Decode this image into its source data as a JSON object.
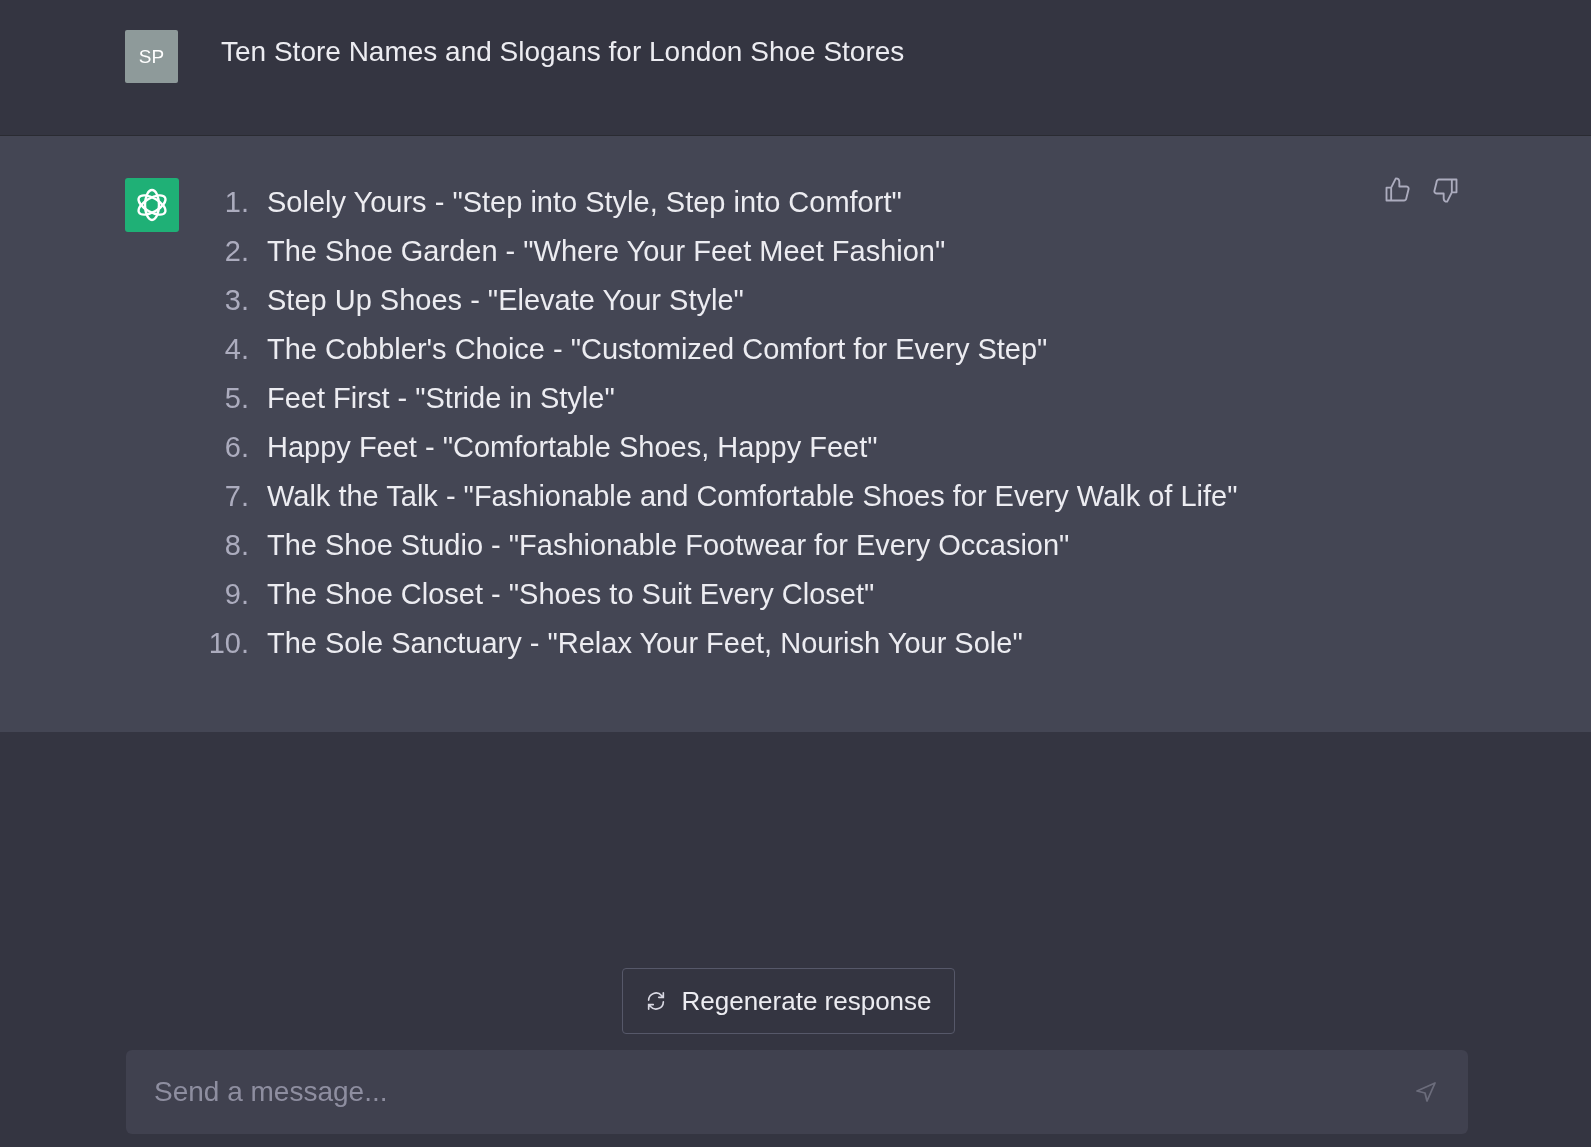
{
  "user_message": {
    "avatar": "SP",
    "text": "Ten Store Names and Slogans for London Shoe Stores"
  },
  "assistant_message": {
    "items": [
      {
        "number": "1.",
        "text": "Solely Yours - \"Step into Style, Step into Comfort\""
      },
      {
        "number": "2.",
        "text": "The Shoe Garden - \"Where Your Feet Meet Fashion\""
      },
      {
        "number": "3.",
        "text": "Step Up Shoes - \"Elevate Your Style\""
      },
      {
        "number": "4.",
        "text": "The Cobbler's Choice - \"Customized Comfort for Every Step\""
      },
      {
        "number": "5.",
        "text": "Feet First - \"Stride in Style\""
      },
      {
        "number": "6.",
        "text": "Happy Feet - \"Comfortable Shoes, Happy Feet\""
      },
      {
        "number": "7.",
        "text": "Walk the Talk - \"Fashionable and Comfortable Shoes for Every Walk of Life\""
      },
      {
        "number": "8.",
        "text": "The Shoe Studio - \"Fashionable Footwear for Every Occasion\""
      },
      {
        "number": "9.",
        "text": "The Shoe Closet - \"Shoes to Suit Every Closet\""
      },
      {
        "number": "10.",
        "text": "The Sole Sanctuary - \"Relax Your Feet, Nourish Your Sole\""
      }
    ]
  },
  "regenerate_button": {
    "label": "Regenerate response"
  },
  "composer": {
    "placeholder": "Send a message..."
  }
}
